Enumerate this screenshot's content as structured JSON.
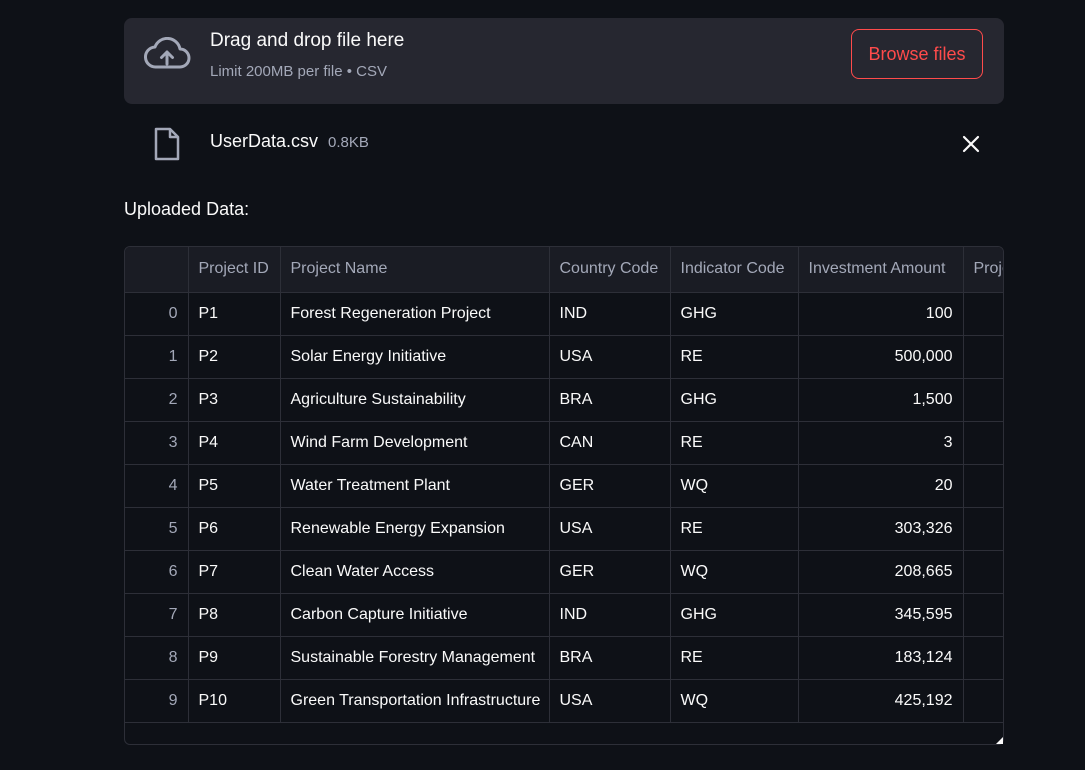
{
  "uploader": {
    "icon": "cloud-upload-icon",
    "title": "Drag and drop file here",
    "limit": "Limit 200MB per file • CSV",
    "browse_label": "Browse files",
    "accent_color": "#ff4b4b"
  },
  "uploaded_file": {
    "icon": "file-icon",
    "name": "UserData.csv",
    "size": "0.8KB",
    "remove_icon": "close-icon"
  },
  "section_label": "Uploaded Data:",
  "table": {
    "columns": [
      "",
      "Project ID",
      "Project Name",
      "Country Code",
      "Indicator Code",
      "Investment Amount",
      "Proje"
    ],
    "rows": [
      [
        "0",
        "P1",
        "Forest Regeneration Project",
        "IND",
        "GHG",
        "100",
        ""
      ],
      [
        "1",
        "P2",
        "Solar Energy Initiative",
        "USA",
        "RE",
        "500,000",
        ""
      ],
      [
        "2",
        "P3",
        "Agriculture Sustainability",
        "BRA",
        "GHG",
        "1,500",
        ""
      ],
      [
        "3",
        "P4",
        "Wind Farm Development",
        "CAN",
        "RE",
        "3",
        ""
      ],
      [
        "4",
        "P5",
        "Water Treatment Plant",
        "GER",
        "WQ",
        "20",
        ""
      ],
      [
        "5",
        "P6",
        "Renewable Energy Expansion",
        "USA",
        "RE",
        "303,326",
        ""
      ],
      [
        "6",
        "P7",
        "Clean Water Access",
        "GER",
        "WQ",
        "208,665",
        ""
      ],
      [
        "7",
        "P8",
        "Carbon Capture Initiative",
        "IND",
        "GHG",
        "345,595",
        ""
      ],
      [
        "8",
        "P9",
        "Sustainable Forestry Management",
        "BRA",
        "RE",
        "183,124",
        ""
      ],
      [
        "9",
        "P10",
        "Green Transportation Infrastructure",
        "USA",
        "WQ",
        "425,192",
        ""
      ]
    ]
  }
}
